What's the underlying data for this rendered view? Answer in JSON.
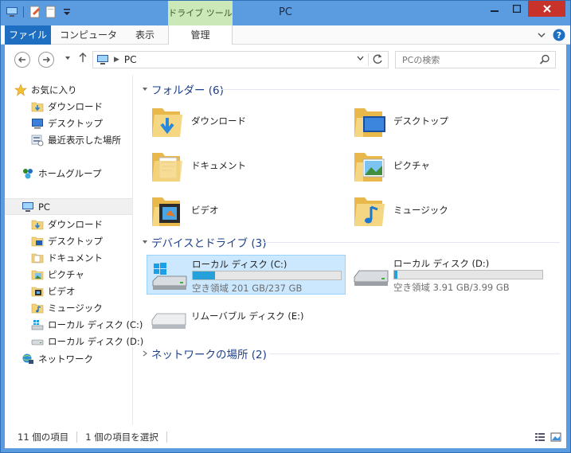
{
  "window": {
    "title": "PC",
    "contextual_tab_group": "ドライブ ツール"
  },
  "ribbon": {
    "tabs": [
      {
        "label": "ファイル"
      },
      {
        "label": "コンピューター"
      },
      {
        "label": "表示"
      },
      {
        "label": "管理"
      }
    ]
  },
  "address": {
    "path": "PC",
    "search_placeholder": "PCの検索"
  },
  "sidebar": {
    "favorites_label": "お気に入り",
    "favorites": [
      {
        "label": "ダウンロード",
        "icon": "download-folder-icon"
      },
      {
        "label": "デスクトップ",
        "icon": "desktop-icon"
      },
      {
        "label": "最近表示した場所",
        "icon": "recent-places-icon"
      }
    ],
    "homegroup_label": "ホームグループ",
    "pc_label": "PC",
    "pc_items": [
      {
        "label": "ダウンロード"
      },
      {
        "label": "デスクトップ"
      },
      {
        "label": "ドキュメント"
      },
      {
        "label": "ピクチャ"
      },
      {
        "label": "ビデオ"
      },
      {
        "label": "ミュージック"
      },
      {
        "label": "ローカル ディスク (C:)"
      },
      {
        "label": "ローカル ディスク (D:)"
      }
    ],
    "network_label": "ネットワーク"
  },
  "content": {
    "folders_header": "フォルダー (6)",
    "folders": [
      {
        "label": "ダウンロード",
        "icon": "download-folder-icon"
      },
      {
        "label": "デスクトップ",
        "icon": "desktop-folder-icon"
      },
      {
        "label": "ドキュメント",
        "icon": "documents-folder-icon"
      },
      {
        "label": "ピクチャ",
        "icon": "pictures-folder-icon"
      },
      {
        "label": "ビデオ",
        "icon": "videos-folder-icon"
      },
      {
        "label": "ミュージック",
        "icon": "music-folder-icon"
      }
    ],
    "devices_header": "デバイスとドライブ (3)",
    "drives": [
      {
        "name": "ローカル ディスク (C:)",
        "space": "空き領域 201 GB/237 GB",
        "used_fraction": 0.15
      },
      {
        "name": "ローカル ディスク (D:)",
        "space": "空き領域 3.91 GB/3.99 GB",
        "used_fraction": 0.02
      },
      {
        "name": "リムーバブル ディスク (E:)"
      }
    ],
    "network_header": "ネットワークの場所 (2)"
  },
  "status": {
    "item_count": "11 個の項目",
    "selected": "1 個の項目を選択"
  },
  "colors": {
    "accent": "#1e6fc2",
    "title_bar": "#5b9bdf",
    "selection": "#cce8ff",
    "group_header": "#1e3f8a",
    "drive_fill": "#26a0da"
  }
}
